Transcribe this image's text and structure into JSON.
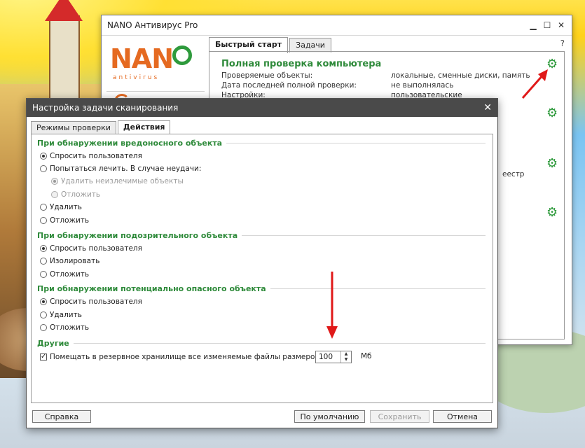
{
  "main_window": {
    "title": "NANO Антивирус Pro",
    "logo": "NAN",
    "logo_sub": "antivirus",
    "tabs": [
      "Быстрый старт",
      "Задачи"
    ],
    "help": "?",
    "task": {
      "title": "Полная проверка компьютера",
      "rows": [
        {
          "label": "Проверяемые объекты:",
          "value": "локальные, сменные диски, память"
        },
        {
          "label": "Дата последней полной проверки:",
          "value": "не выполнялась"
        },
        {
          "label": "Настройки:",
          "value": "пользовательские"
        }
      ]
    },
    "partial_text": "еестр"
  },
  "dialog": {
    "title": "Настройка задачи сканирования",
    "close": "✕",
    "tabs": [
      "Режимы проверки",
      "Действия"
    ],
    "sections": {
      "malicious": {
        "title": "При обнаружении вредоносного объекта",
        "options": [
          "Спросить пользователя",
          "Попытаться лечить. В случае неудачи:",
          "Удалить неизлечимые объекты",
          "Отложить",
          "Удалить",
          "Отложить"
        ]
      },
      "suspicious": {
        "title": "При обнаружении подозрительного объекта",
        "options": [
          "Спросить пользователя",
          "Изолировать",
          "Отложить"
        ]
      },
      "potential": {
        "title": "При обнаружении потенциально опасного объекта",
        "options": [
          "Спросить пользователя",
          "Удалить",
          "Отложить"
        ]
      },
      "other": {
        "title": "Другие",
        "backup_label": "Помещать в резервное хранилище все изменяемые файлы размером менее",
        "backup_checked": true,
        "size_value": "100",
        "size_unit": "Мб"
      }
    },
    "buttons": {
      "help": "Справка",
      "defaults": "По умолчанию",
      "save": "Сохранить",
      "cancel": "Отмена"
    }
  },
  "colors": {
    "accent_green": "#2e8a3a",
    "logo_orange": "#e56a21",
    "arrow_red": "#e01919"
  }
}
